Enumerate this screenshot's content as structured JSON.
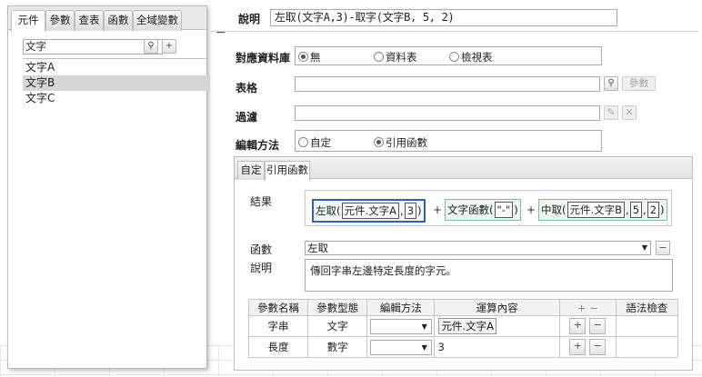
{
  "left_tabs": [
    "元件",
    "參數",
    "查表",
    "函數",
    "全域變數"
  ],
  "search": {
    "value": "文字"
  },
  "components": [
    {
      "label": "文字A",
      "selected": false
    },
    {
      "label": "文字B",
      "selected": true
    },
    {
      "label": "文字C",
      "selected": false
    }
  ],
  "description": {
    "label": "說明",
    "value": "左取(文字A,3)-取字(文字B, 5, 2)"
  },
  "source_table": {
    "label": "對應資料庫",
    "options": [
      "無",
      "資料表",
      "檢視表"
    ],
    "selected": "無"
  },
  "table_field": {
    "label": "表格",
    "param_button": "參數"
  },
  "filter_field": {
    "label": "過濾"
  },
  "edit_method": {
    "label": "編輯方法",
    "options": [
      "自定",
      "引用函數"
    ],
    "selected": "引用函數"
  },
  "inner_tabs": [
    "自定",
    "引用函數"
  ],
  "result": {
    "label": "結果",
    "left": {
      "func": "左取(",
      "arg1": "元件.文字A",
      "sep": ",",
      "arg2": "3",
      "close": ")"
    },
    "plus1": "+",
    "middle": {
      "func": "文字函數(",
      "arg1": "\"-\"",
      "close": ")"
    },
    "plus2": "+",
    "right": {
      "func": "中取(",
      "arg1": "元件.文字B",
      "sep1": ",",
      "arg2": "5",
      "sep2": ",",
      "arg3": "2",
      "close": ")"
    }
  },
  "function_field": {
    "label": "函數",
    "value": "左取"
  },
  "func_desc": {
    "label": "說明",
    "value": "傳回字串左邊特定長度的字元。"
  },
  "param_table": {
    "headers": [
      "參數名稱",
      "參數型態",
      "編輯方法",
      "運算內容",
      "+ −",
      "語法檢查"
    ],
    "rows": [
      {
        "name": "字串",
        "type": "文字",
        "content": "元件.文字A"
      },
      {
        "name": "長度",
        "type": "數字",
        "content": "3"
      }
    ]
  }
}
